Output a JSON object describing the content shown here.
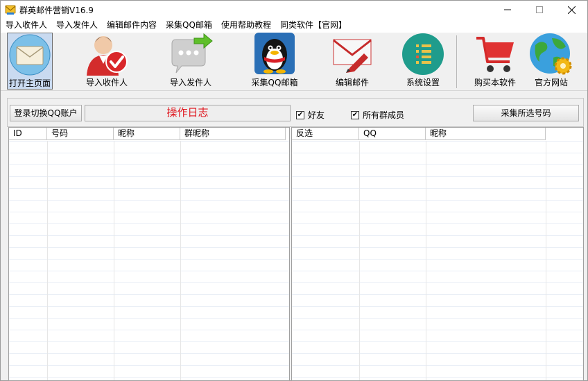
{
  "window": {
    "title": "群英邮件营销V16.9"
  },
  "menu": [
    "导入收件人",
    "导入发件人",
    "编辑邮件内容",
    "采集QQ邮箱",
    "使用帮助教程",
    "同类软件【官网】"
  ],
  "toolbar": [
    {
      "label": "打开主页面",
      "icon": "envelope-icon",
      "active": true
    },
    {
      "label": "导入收件人",
      "icon": "user-check-icon"
    },
    {
      "label": "导入发件人",
      "icon": "chat-arrow-icon"
    },
    {
      "label": "采集QQ邮箱",
      "icon": "qq-penguin-icon"
    },
    {
      "label": "编辑邮件",
      "icon": "mail-edit-icon"
    },
    {
      "label": "系统设置",
      "icon": "settings-list-icon"
    },
    {
      "label": "购买本软件",
      "icon": "shopping-cart-icon"
    },
    {
      "label": "官方网站",
      "icon": "globe-gear-icon"
    }
  ],
  "controls": {
    "login_button": "登录切换QQ账户",
    "log_label": "操作日志",
    "friends_label": "好友",
    "friends_checked": true,
    "members_label": "所有群成员",
    "members_checked": true,
    "collect_button": "采集所选号码"
  },
  "left_table": {
    "columns": [
      "ID",
      "号码",
      "昵称",
      "群昵称"
    ],
    "rows": []
  },
  "right_table": {
    "columns": [
      "反选",
      "QQ",
      "昵称"
    ],
    "rows": []
  },
  "colors": {
    "log_text": "#e0141c",
    "active_tool_bg": "#c9daf0"
  }
}
